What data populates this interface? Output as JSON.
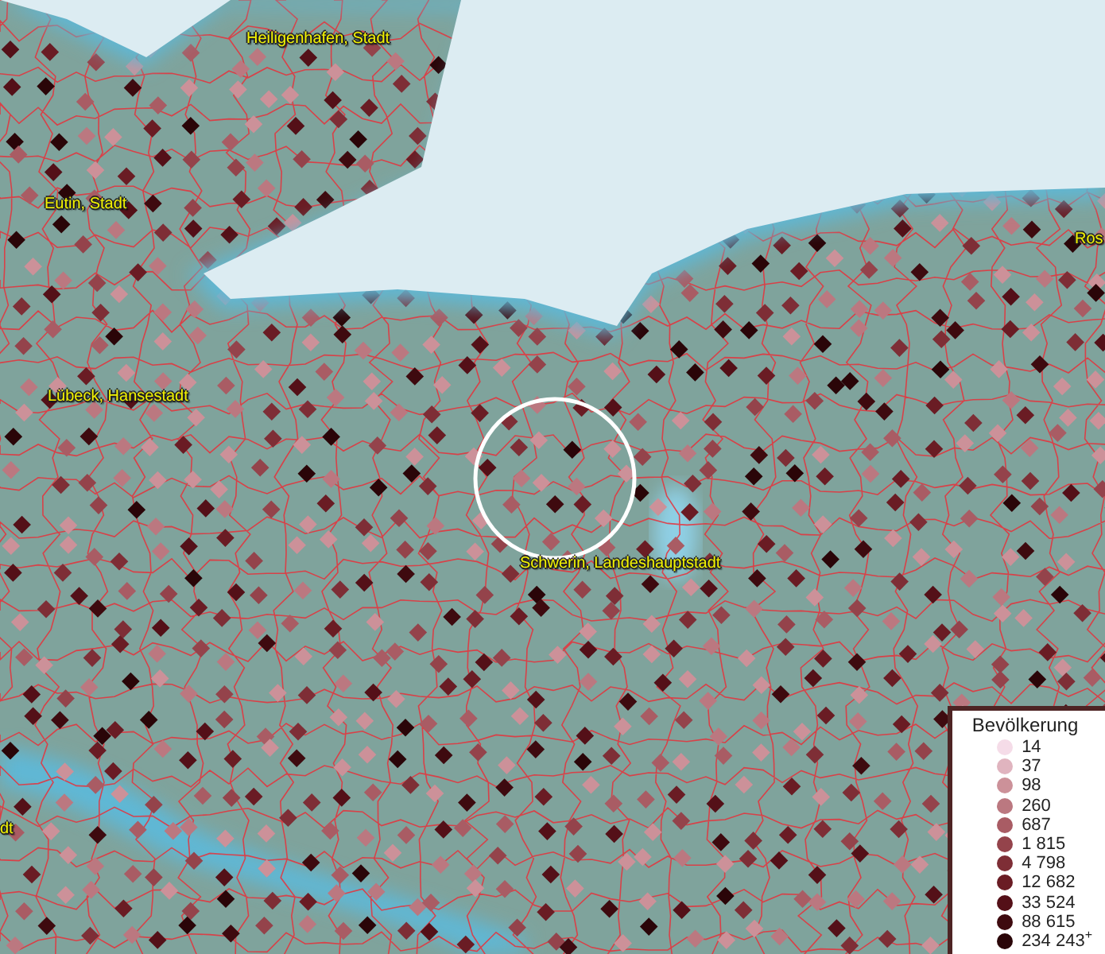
{
  "map": {
    "places": [
      {
        "name": "Heiligenhafen, Stadt"
      },
      {
        "name": "Eutin, Stadt"
      },
      {
        "name": "Lübeck, Hansestadt"
      },
      {
        "name": "Schwerin, Landeshauptstadt"
      },
      {
        "name": "Ros"
      },
      {
        "name": "dt"
      }
    ]
  },
  "legend": {
    "title": "Bevölkerung",
    "entries": [
      {
        "label": "14",
        "color": "#f5dce8"
      },
      {
        "label": "37",
        "color": "#e0b4bf"
      },
      {
        "label": "98",
        "color": "#cc9199"
      },
      {
        "label": "260",
        "color": "#bb7880"
      },
      {
        "label": "687",
        "color": "#a95c64"
      },
      {
        "label": "1 815",
        "color": "#94434b"
      },
      {
        "label": "4 798",
        "color": "#7e2e36"
      },
      {
        "label": "12 682",
        "color": "#6a1c24"
      },
      {
        "label": "33 524",
        "color": "#541018"
      },
      {
        "label": "88 615",
        "color": "#3e0a0f"
      },
      {
        "label": "234 243$^{+}$",
        "color": "#2a0508"
      }
    ]
  }
}
